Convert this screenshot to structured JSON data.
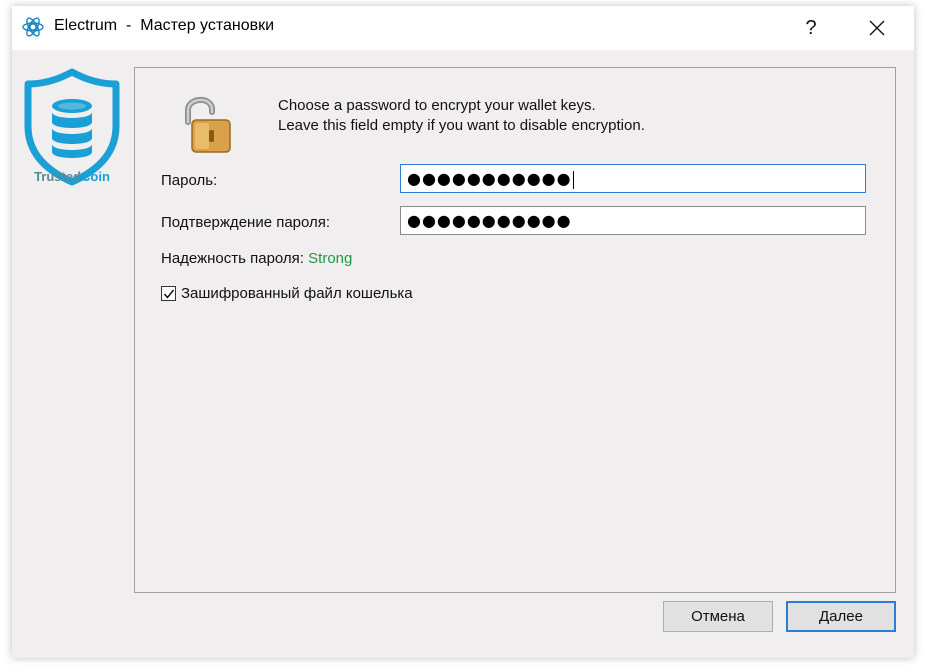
{
  "window": {
    "title": "Electrum  -  Мастер установки",
    "help_label": "?",
    "close_label": "✕"
  },
  "sidebar": {
    "logo_text_1": "Trusted",
    "logo_text_2": "Coin"
  },
  "main": {
    "intro_line_1": "Choose a password to encrypt your wallet keys.",
    "intro_line_2": "Leave this field empty if you want to disable encryption.",
    "password_label": "Пароль:",
    "password_value": "●●●●●●●●●●●",
    "confirm_label": "Подтверждение пароля:",
    "confirm_value": "●●●●●●●●●●●",
    "strength_label": "Надежность пароля:",
    "strength_value": "Strong",
    "encrypt_checkbox_label": "Зашифрованный файл кошелька",
    "encrypt_checked": true
  },
  "buttons": {
    "cancel": "Отмена",
    "next": "Далее"
  },
  "colors": {
    "strength_strong": "#1e9a43",
    "accent": "#2f7bd6",
    "brand": "#1a9fd6"
  }
}
